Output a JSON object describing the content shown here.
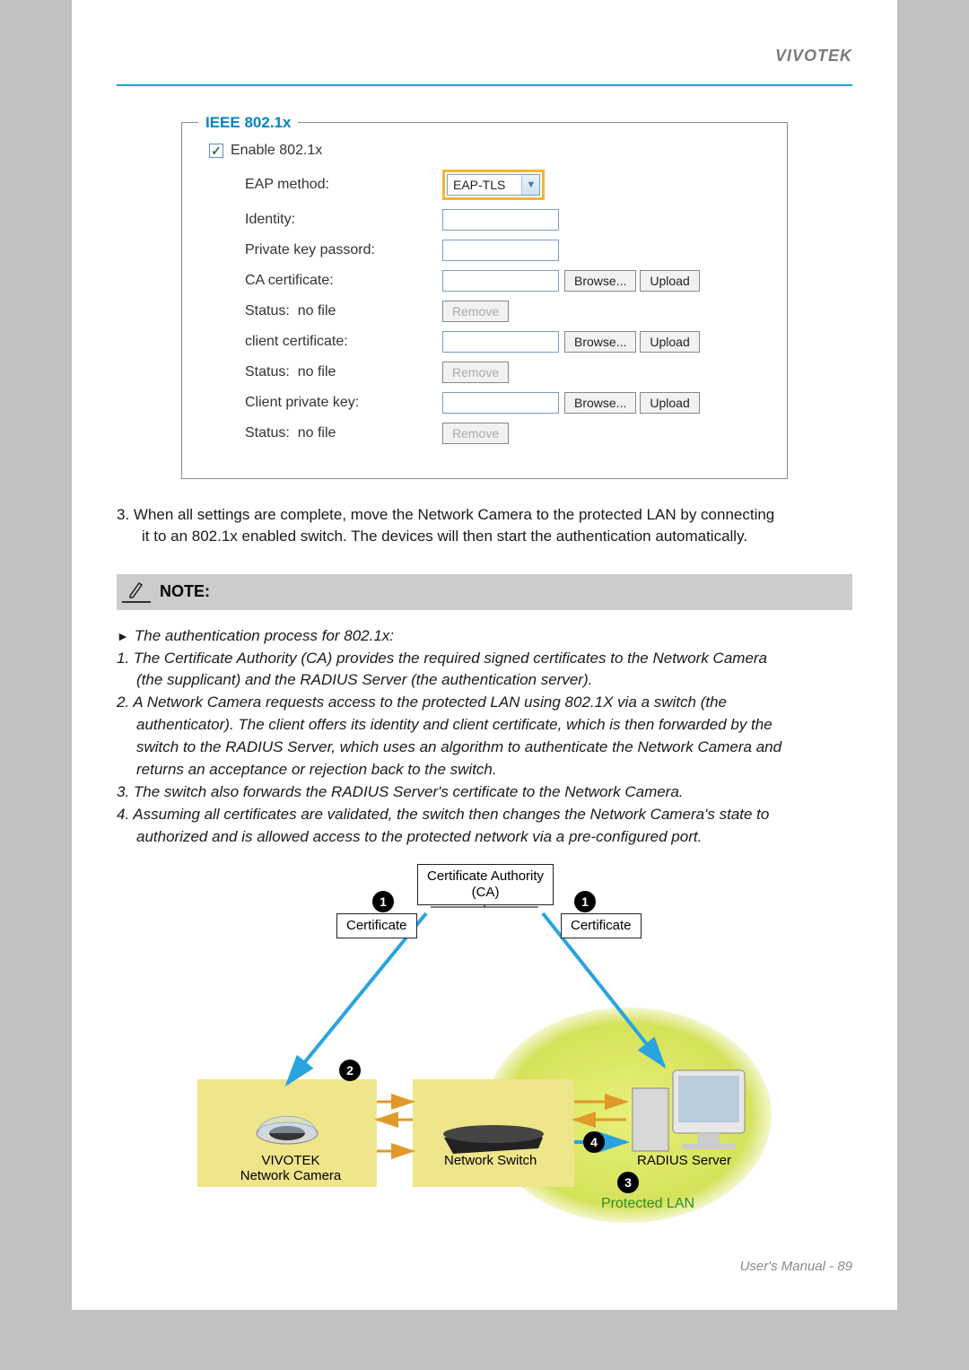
{
  "brand": "VIVOTEK",
  "fieldset": {
    "legend": "IEEE 802.1x",
    "enable_label": "Enable 802.1x",
    "eap_method_label": "EAP method:",
    "eap_method_value": "EAP-TLS",
    "identity_label": "Identity:",
    "private_key_pw_label": "Private key passord:",
    "ca_cert_label": "CA certificate:",
    "client_cert_label": "client certificate:",
    "client_pk_label": "Client private key:",
    "status_label": "Status:",
    "status_value": "no file",
    "browse_btn": "Browse...",
    "upload_btn": "Upload",
    "remove_btn": "Remove"
  },
  "step3_lead": "3. ",
  "step3_line1": "When all settings are complete, move the Network Camera to the protected LAN by connecting",
  "step3_line2": "it to an 802.1x enabled switch. The devices will then start the authentication automatically.",
  "note_title": "NOTE:",
  "note": {
    "intro": "The authentication process for 802.1x:",
    "p1a": "1. The Certificate Authority (CA) provides the required signed certificates to the Network Camera",
    "p1b": "(the supplicant) and the RADIUS Server (the authentication server).",
    "p2a": "2. A Network Camera requests access to the protected LAN using 802.1X via a switch (the",
    "p2b": "authenticator). The client offers its identity and client certificate, which is then forwarded by the",
    "p2c": "switch to the RADIUS Server, which uses an algorithm to authenticate the Network Camera and",
    "p2d": "returns an acceptance or rejection back to the switch.",
    "p3": "3. The switch also forwards the RADIUS Server's certificate to the Network Camera.",
    "p4a": "4. Assuming all certificates are validated, the switch then changes the Network Camera's state to",
    "p4b": "authorized and is allowed access to the protected network via a pre-configured port."
  },
  "diagram": {
    "ca": "Certificate Authority\n(CA)",
    "ca_line1": "Certificate Authority",
    "ca_line2": "(CA)",
    "cert": "Certificate",
    "vivotek_cam": "VIVOTEK\nNetwork Camera",
    "vivotek": "VIVOTEK",
    "net_cam": "Network Camera",
    "switch": "Network Switch",
    "radius": "RADIUS Server",
    "protected": "Protected LAN",
    "n1": "1",
    "n2": "2",
    "n3": "3",
    "n4": "4"
  },
  "footer_text": "User's Manual - ",
  "footer_page": "89"
}
